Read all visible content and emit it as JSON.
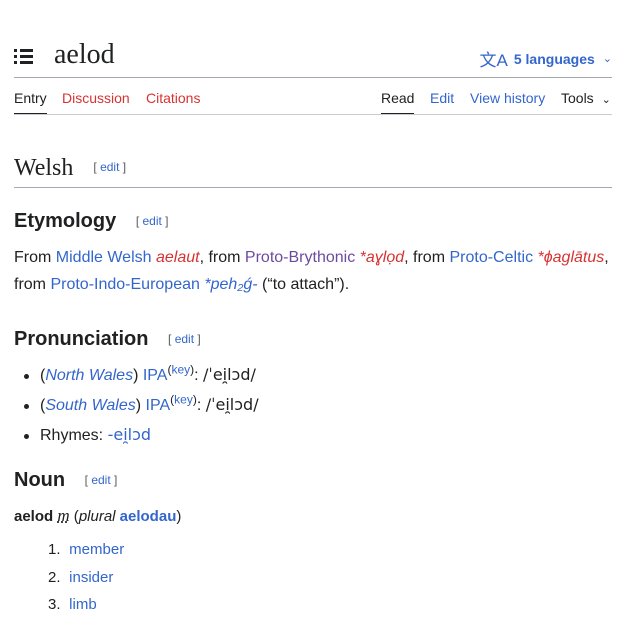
{
  "header": {
    "title": "aelod",
    "languages_label": "5 languages",
    "language_icon": "translate-icon",
    "menu_icon": "table-of-contents-icon"
  },
  "tabs": {
    "left": [
      "Entry",
      "Discussion",
      "Citations"
    ],
    "right": [
      "Read",
      "Edit",
      "View history"
    ],
    "tools": "Tools"
  },
  "language_section": {
    "heading": "Welsh",
    "edit": "edit"
  },
  "etymology": {
    "heading": "Etymology",
    "edit": "edit",
    "t1": "From ",
    "l1": "Middle Welsh",
    "f1": "aelaut",
    "t2": ", from ",
    "l2": "Proto-Brythonic",
    "f2": "*aɣlọd",
    "t3": ", from ",
    "l3": "Proto-Celtic",
    "f3": "*ɸaglātus",
    "t4": ",",
    "t5": "from ",
    "l4": "Proto-Indo-European",
    "f4": "*peh₂ǵ-",
    "gloss": " (“to attach”)."
  },
  "pronunciation": {
    "heading": "Pronunciation",
    "edit": "edit",
    "north_label": "North Wales",
    "south_label": "South Wales",
    "ipa_label": "IPA",
    "key_label": "key",
    "north_ipa": "/ˈei̯lɔd/",
    "south_ipa": "/ˈei̯lɔd/",
    "rhymes_label": "Rhymes:",
    "rhymes_value": "-ei̯lɔd"
  },
  "noun": {
    "heading": "Noun",
    "edit": "edit",
    "headword": "aelod",
    "gender": "m",
    "plural_label": "plural",
    "plural": "aelodau",
    "senses": [
      "member",
      "insider",
      "limb"
    ]
  },
  "colors": {
    "link": "#3366cc",
    "redlink": "#d73333",
    "visited": "#6b4ba1",
    "text": "#202122"
  }
}
